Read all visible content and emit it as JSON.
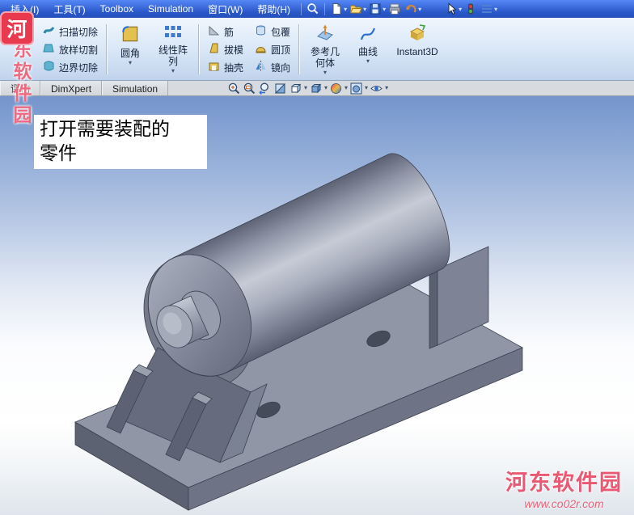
{
  "menu_bar": {
    "items": [
      "插入(I)",
      "工具(T)",
      "Toolbox",
      "Simulation",
      "窗口(W)",
      "帮助(H)"
    ]
  },
  "quick_toolbar": {
    "icons": [
      "search",
      "new-document",
      "open",
      "save",
      "print",
      "undo",
      "select-arrow",
      "rebuild-traffic-light",
      "options-list"
    ]
  },
  "ribbon": {
    "cut_group": [
      "扫描切除",
      "放样切割",
      "边界切除"
    ],
    "fillet_label": "圆角",
    "pattern_label": "线性阵列",
    "feature_group": [
      "筋",
      "拔模",
      "抽壳"
    ],
    "wrap_group": [
      "包覆",
      "圆顶",
      "镜向"
    ],
    "reference_label": "参考几何体",
    "curve_label": "曲线",
    "instant3d_label": "Instant3D"
  },
  "tabs": [
    "评估",
    "DimXpert",
    "Simulation"
  ],
  "headsup": {
    "icons": [
      "zoom-fit",
      "zoom-area",
      "previous-view",
      "section-view",
      "view-orientation",
      "display-style",
      "edit-appearance",
      "apply-scene",
      "view-settings"
    ]
  },
  "viewport": {
    "annotation_line1": "打开需要装配的",
    "annotation_line2": "零件"
  },
  "watermark": {
    "logo_text": "河",
    "vertical_text": "河东软件园",
    "site_name": "河东软件园",
    "site_url": "www.co02r.com"
  },
  "colors": {
    "menu_gradient_top": "#5587f5",
    "menu_gradient_bottom": "#2a57c8",
    "ribbon_background": "#dcе9f8",
    "viewport_sky": "#7495cc",
    "model_gray": "#9096a6",
    "watermark_red": "#e8506a"
  }
}
